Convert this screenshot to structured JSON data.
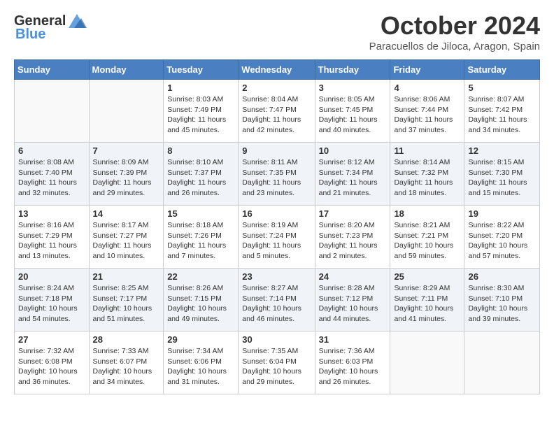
{
  "header": {
    "logo_general": "General",
    "logo_blue": "Blue",
    "month_year": "October 2024",
    "location": "Paracuellos de Jiloca, Aragon, Spain"
  },
  "weekdays": [
    "Sunday",
    "Monday",
    "Tuesday",
    "Wednesday",
    "Thursday",
    "Friday",
    "Saturday"
  ],
  "weeks": [
    [
      {
        "day": "",
        "info": ""
      },
      {
        "day": "",
        "info": ""
      },
      {
        "day": "1",
        "info": "Sunrise: 8:03 AM\nSunset: 7:49 PM\nDaylight: 11 hours and 45 minutes."
      },
      {
        "day": "2",
        "info": "Sunrise: 8:04 AM\nSunset: 7:47 PM\nDaylight: 11 hours and 42 minutes."
      },
      {
        "day": "3",
        "info": "Sunrise: 8:05 AM\nSunset: 7:45 PM\nDaylight: 11 hours and 40 minutes."
      },
      {
        "day": "4",
        "info": "Sunrise: 8:06 AM\nSunset: 7:44 PM\nDaylight: 11 hours and 37 minutes."
      },
      {
        "day": "5",
        "info": "Sunrise: 8:07 AM\nSunset: 7:42 PM\nDaylight: 11 hours and 34 minutes."
      }
    ],
    [
      {
        "day": "6",
        "info": "Sunrise: 8:08 AM\nSunset: 7:40 PM\nDaylight: 11 hours and 32 minutes."
      },
      {
        "day": "7",
        "info": "Sunrise: 8:09 AM\nSunset: 7:39 PM\nDaylight: 11 hours and 29 minutes."
      },
      {
        "day": "8",
        "info": "Sunrise: 8:10 AM\nSunset: 7:37 PM\nDaylight: 11 hours and 26 minutes."
      },
      {
        "day": "9",
        "info": "Sunrise: 8:11 AM\nSunset: 7:35 PM\nDaylight: 11 hours and 23 minutes."
      },
      {
        "day": "10",
        "info": "Sunrise: 8:12 AM\nSunset: 7:34 PM\nDaylight: 11 hours and 21 minutes."
      },
      {
        "day": "11",
        "info": "Sunrise: 8:14 AM\nSunset: 7:32 PM\nDaylight: 11 hours and 18 minutes."
      },
      {
        "day": "12",
        "info": "Sunrise: 8:15 AM\nSunset: 7:30 PM\nDaylight: 11 hours and 15 minutes."
      }
    ],
    [
      {
        "day": "13",
        "info": "Sunrise: 8:16 AM\nSunset: 7:29 PM\nDaylight: 11 hours and 13 minutes."
      },
      {
        "day": "14",
        "info": "Sunrise: 8:17 AM\nSunset: 7:27 PM\nDaylight: 11 hours and 10 minutes."
      },
      {
        "day": "15",
        "info": "Sunrise: 8:18 AM\nSunset: 7:26 PM\nDaylight: 11 hours and 7 minutes."
      },
      {
        "day": "16",
        "info": "Sunrise: 8:19 AM\nSunset: 7:24 PM\nDaylight: 11 hours and 5 minutes."
      },
      {
        "day": "17",
        "info": "Sunrise: 8:20 AM\nSunset: 7:23 PM\nDaylight: 11 hours and 2 minutes."
      },
      {
        "day": "18",
        "info": "Sunrise: 8:21 AM\nSunset: 7:21 PM\nDaylight: 10 hours and 59 minutes."
      },
      {
        "day": "19",
        "info": "Sunrise: 8:22 AM\nSunset: 7:20 PM\nDaylight: 10 hours and 57 minutes."
      }
    ],
    [
      {
        "day": "20",
        "info": "Sunrise: 8:24 AM\nSunset: 7:18 PM\nDaylight: 10 hours and 54 minutes."
      },
      {
        "day": "21",
        "info": "Sunrise: 8:25 AM\nSunset: 7:17 PM\nDaylight: 10 hours and 51 minutes."
      },
      {
        "day": "22",
        "info": "Sunrise: 8:26 AM\nSunset: 7:15 PM\nDaylight: 10 hours and 49 minutes."
      },
      {
        "day": "23",
        "info": "Sunrise: 8:27 AM\nSunset: 7:14 PM\nDaylight: 10 hours and 46 minutes."
      },
      {
        "day": "24",
        "info": "Sunrise: 8:28 AM\nSunset: 7:12 PM\nDaylight: 10 hours and 44 minutes."
      },
      {
        "day": "25",
        "info": "Sunrise: 8:29 AM\nSunset: 7:11 PM\nDaylight: 10 hours and 41 minutes."
      },
      {
        "day": "26",
        "info": "Sunrise: 8:30 AM\nSunset: 7:10 PM\nDaylight: 10 hours and 39 minutes."
      }
    ],
    [
      {
        "day": "27",
        "info": "Sunrise: 7:32 AM\nSunset: 6:08 PM\nDaylight: 10 hours and 36 minutes."
      },
      {
        "day": "28",
        "info": "Sunrise: 7:33 AM\nSunset: 6:07 PM\nDaylight: 10 hours and 34 minutes."
      },
      {
        "day": "29",
        "info": "Sunrise: 7:34 AM\nSunset: 6:06 PM\nDaylight: 10 hours and 31 minutes."
      },
      {
        "day": "30",
        "info": "Sunrise: 7:35 AM\nSunset: 6:04 PM\nDaylight: 10 hours and 29 minutes."
      },
      {
        "day": "31",
        "info": "Sunrise: 7:36 AM\nSunset: 6:03 PM\nDaylight: 10 hours and 26 minutes."
      },
      {
        "day": "",
        "info": ""
      },
      {
        "day": "",
        "info": ""
      }
    ]
  ]
}
